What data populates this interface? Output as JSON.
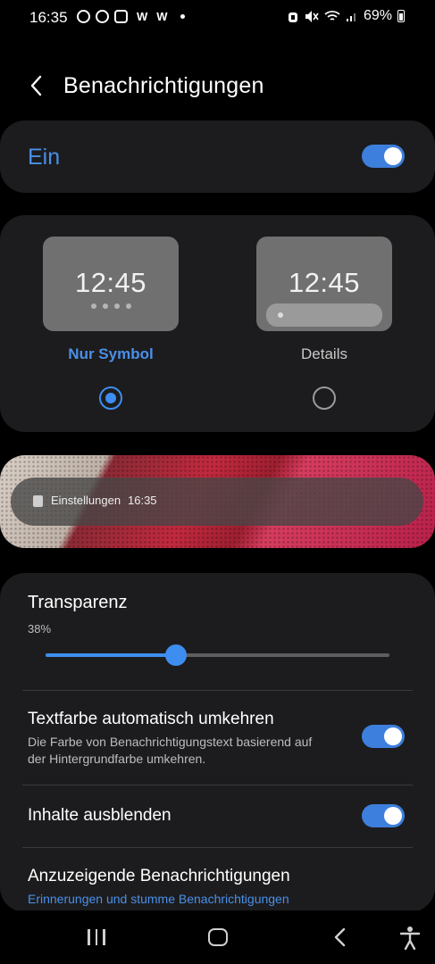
{
  "status_bar": {
    "time": "16:35",
    "left_letters": [
      "W",
      "W"
    ],
    "battery": "69%"
  },
  "header": {
    "title": "Benachrichtigungen"
  },
  "main_toggle": {
    "label": "Ein",
    "on": true
  },
  "style_options": {
    "preview_time": "12:45",
    "icon_only": {
      "label": "Nur Symbol",
      "selected": true
    },
    "details": {
      "label": "Details",
      "selected": false
    }
  },
  "preview_notification": {
    "app": "Einstellungen",
    "time": "16:35"
  },
  "transparency": {
    "title": "Transparenz",
    "value_text": "38%",
    "value": 0.38
  },
  "rows": {
    "invert_text": {
      "title": "Textfarbe automatisch umkehren",
      "subtitle": "Die Farbe von Benachrichtigungstext basierend auf der Hintergrundfarbe umkehren.",
      "on": true
    },
    "hide_content": {
      "title": "Inhalte ausblenden",
      "on": true
    },
    "shown_notifications": {
      "title": "Anzuzeigende Benachrichtigungen",
      "link": "Erinnerungen und stumme Benachrichtigungen"
    }
  },
  "colors": {
    "accent": "#3d8ef0",
    "card": "#1c1c1e",
    "background": "#000000"
  }
}
